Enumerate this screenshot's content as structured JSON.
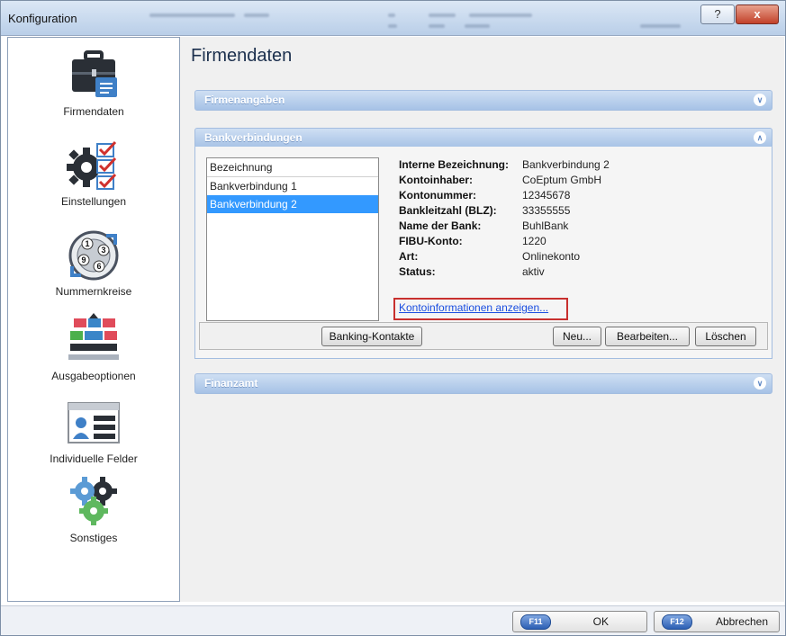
{
  "window": {
    "title": "Konfiguration",
    "help_label": "?",
    "close_label": "x"
  },
  "sidebar": {
    "items": [
      {
        "label": "Firmendaten"
      },
      {
        "label": "Einstellungen"
      },
      {
        "label": "Nummernkreise"
      },
      {
        "label": "Ausgabeoptionen"
      },
      {
        "label": "Individuelle Felder"
      },
      {
        "label": "Sonstiges"
      }
    ]
  },
  "main": {
    "title": "Firmendaten",
    "sections": {
      "firmenangaben": "Firmenangaben",
      "bankverbindungen": "Bankverbindungen",
      "finanzamt": "Finanzamt"
    },
    "bank_list": {
      "header": "Bezeichnung",
      "items": [
        "Bankverbindung 1",
        "Bankverbindung 2"
      ],
      "selected": "Bankverbindung 2"
    },
    "details": [
      {
        "label": "Interne Bezeichnung:",
        "value": "Bankverbindung 2"
      },
      {
        "label": "Kontoinhaber:",
        "value": "CoEptum GmbH"
      },
      {
        "label": "Kontonummer:",
        "value": "12345678"
      },
      {
        "label": "Bankleitzahl (BLZ):",
        "value": "33355555"
      },
      {
        "label": "Name der Bank:",
        "value": "BuhlBank"
      },
      {
        "label": "FIBU-Konto:",
        "value": "1220"
      },
      {
        "label": "Art:",
        "value": "Onlinekonto"
      },
      {
        "label": "Status:",
        "value": "aktiv"
      }
    ],
    "link": "Kontoinformationen anzeigen...",
    "buttons": {
      "banking": "Banking-Kontakte",
      "neu": "Neu...",
      "bearbeiten": "Bearbeiten...",
      "loeschen": "Löschen"
    }
  },
  "footer": {
    "ok_key": "F11",
    "ok_label": "OK",
    "cancel_key": "F12",
    "cancel_label": "Abbrechen"
  },
  "colors": {
    "section_bar": "#a6c2e6",
    "selection": "#3399ff",
    "highlight_box": "#c8302e",
    "link": "#1a4ee0"
  }
}
